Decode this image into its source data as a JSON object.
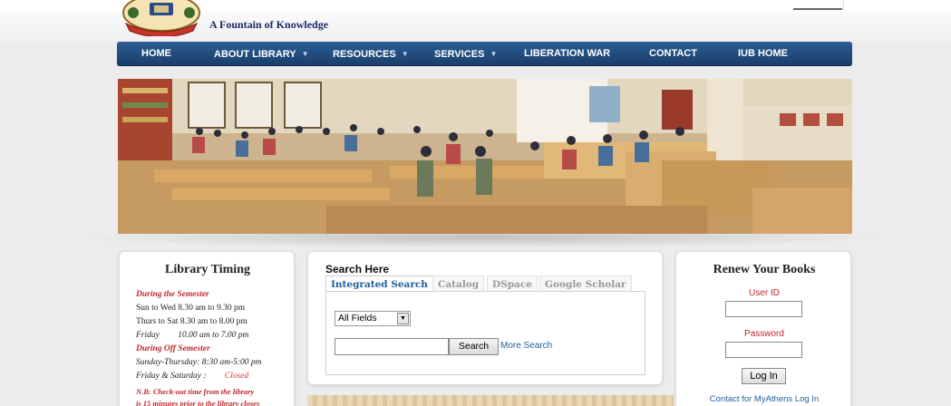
{
  "header": {
    "tagline": "A Fountain of Knowledge"
  },
  "nav": {
    "items": [
      {
        "label": "HOME",
        "dropdown": false
      },
      {
        "label": "ABOUT LIBRARY",
        "dropdown": true
      },
      {
        "label": "RESOURCES",
        "dropdown": true
      },
      {
        "label": "SERVICES",
        "dropdown": true
      },
      {
        "label": "LIBERATION WAR",
        "dropdown": false
      },
      {
        "label": "CONTACT",
        "dropdown": false
      },
      {
        "label": "IUB HOME",
        "dropdown": false
      }
    ]
  },
  "timing": {
    "title": "Library Timing",
    "during_semester": "During the Semester",
    "row1": "Sun to Wed    8.30 am to 9.30 pm",
    "row2": "Thurs to Sat   8.30 am to 8.00 pm",
    "row3_day": "Friday",
    "row3_time": "10.00 am to 7.00 pm",
    "off_semester": "During Off Semester",
    "row4": "Sunday-Thursday: 8:30 am-5:00 pm",
    "row5_day": "Friday & Saturday :",
    "row5_status": "Closed",
    "note1": "N.B: Check-out time from the library",
    "note2": "is 15 minutes prior to the library closes"
  },
  "search": {
    "title": "Search Here",
    "tabs": [
      "Integrated Search",
      "Catalog",
      "DSpace",
      "Google Scholar"
    ],
    "field_select": "All Fields",
    "input_value": "",
    "button": "Search",
    "more_link": "More Search"
  },
  "renew": {
    "title": "Renew Your Books",
    "user_label": "User ID",
    "password_label": "Password",
    "login_button": "Log In",
    "contact_link": "Contact for MyAthens Log In"
  },
  "colors": {
    "nav": "#1a3e6b",
    "accent_red": "#c0262c",
    "link_blue": "#1e5f9c"
  }
}
